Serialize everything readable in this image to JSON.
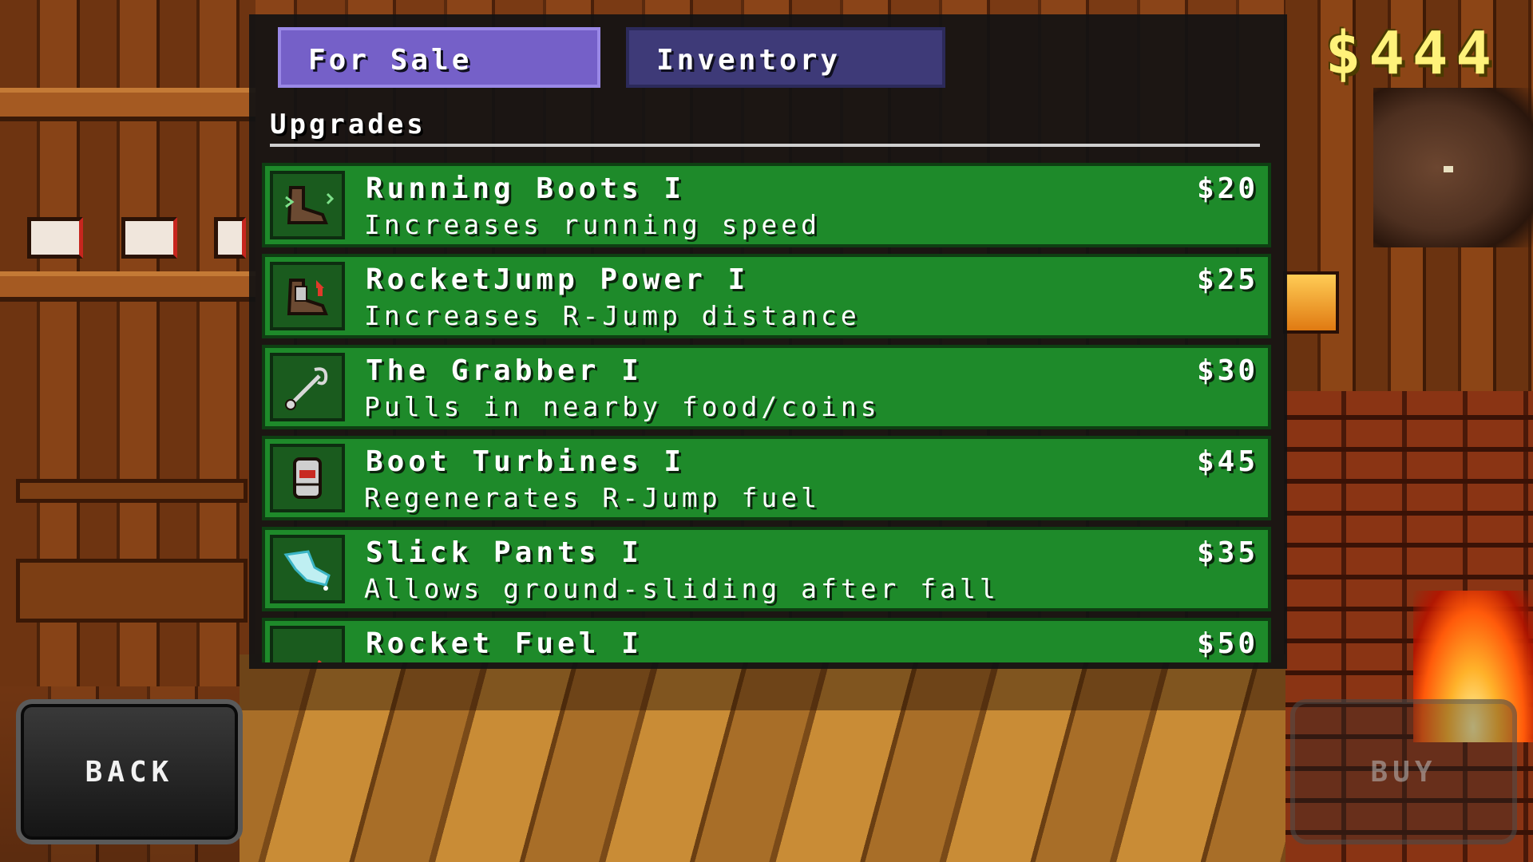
{
  "hud": {
    "money": "$444"
  },
  "tabs": [
    {
      "label": "For Sale",
      "active": true
    },
    {
      "label": "Inventory",
      "active": false
    }
  ],
  "section": {
    "title": "Upgrades"
  },
  "items": [
    {
      "name": "Running Boots I",
      "description": "Increases running speed",
      "price": "$20",
      "icon": "boot-icon"
    },
    {
      "name": "RocketJump Power I",
      "description": "Increases R-Jump distance",
      "price": "$25",
      "icon": "rocket-boot-icon"
    },
    {
      "name": "The Grabber I",
      "description": "Pulls in nearby food/coins",
      "price": "$30",
      "icon": "grabber-icon"
    },
    {
      "name": "Boot Turbines I",
      "description": "Regenerates R-Jump fuel",
      "price": "$45",
      "icon": "turbine-icon"
    },
    {
      "name": "Slick Pants I",
      "description": "Allows ground-sliding after fall",
      "price": "$35",
      "icon": "pants-icon"
    },
    {
      "name": "Rocket Fuel I",
      "description": "",
      "price": "$50",
      "icon": "fuel-can-icon"
    }
  ],
  "buttons": {
    "back": "BACK",
    "buy": "BUY"
  },
  "colors": {
    "tab_active": "#7560c8",
    "tab_inactive": "#3e3a78",
    "item_bg": "#1e8a2a",
    "money": "#fff27a"
  }
}
